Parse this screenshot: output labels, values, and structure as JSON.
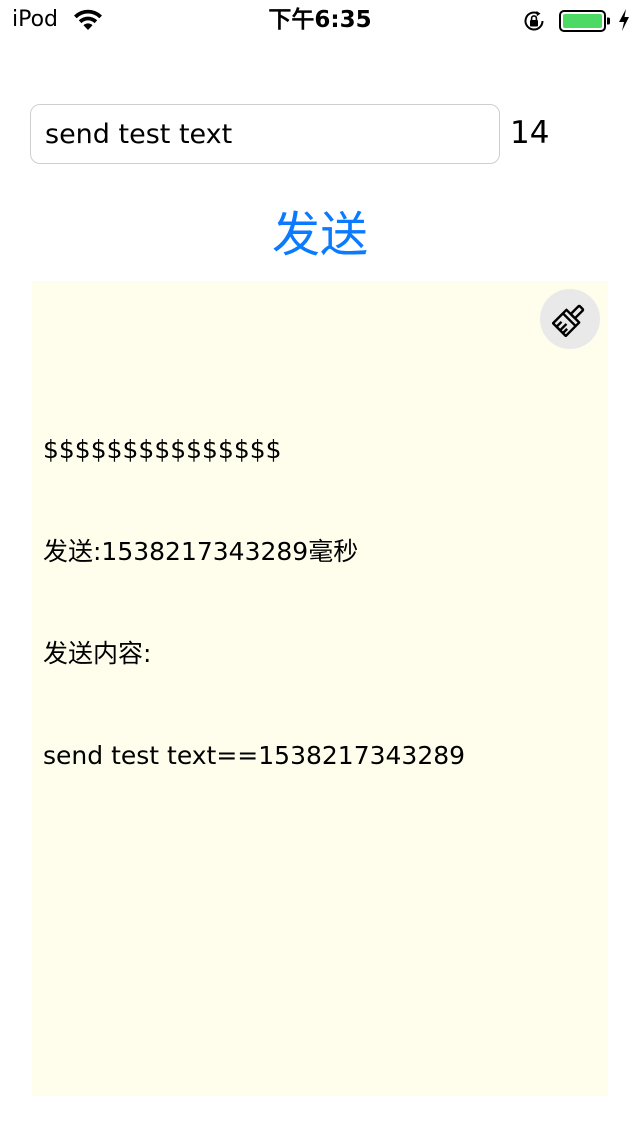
{
  "status_bar": {
    "carrier": "iPod",
    "time": "下午6:35",
    "battery_color": "#4cd964",
    "icons": [
      "wifi-icon",
      "orientation-lock-icon",
      "battery-icon",
      "charging-bolt-icon"
    ]
  },
  "input": {
    "value": "send test text",
    "count": "14"
  },
  "send_button": {
    "label": "发送",
    "color": "#0a7aff"
  },
  "log": {
    "background_color": "#fffeec",
    "clear_icon": "brush-icon",
    "lines": [
      "$$$$$$$$$$$$$$$",
      "发送:1538217343289毫秒",
      "发送内容:",
      "send test text==1538217343289"
    ]
  }
}
